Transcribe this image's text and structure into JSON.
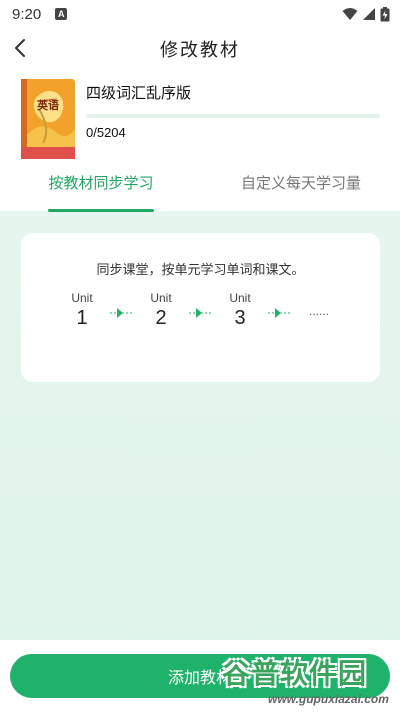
{
  "status_bar": {
    "time": "9:20",
    "badge": "A"
  },
  "header": {
    "title": "修改教材"
  },
  "book": {
    "name": "四级词汇乱序版",
    "cover_text": "英语",
    "progress_text": "0/5204",
    "progress_fraction": 0.0
  },
  "tabs": [
    {
      "label": "按教材同步学习",
      "active": true
    },
    {
      "label": "自定义每天学习量",
      "active": false
    }
  ],
  "sync_card": {
    "description": "同步课堂，按单元学习单词和课文。",
    "units": [
      {
        "label": "Unit",
        "number": "1"
      },
      {
        "label": "Unit",
        "number": "2"
      },
      {
        "label": "Unit",
        "number": "3"
      }
    ],
    "ellipsis": "......"
  },
  "bottom": {
    "button_label": "添加教材"
  },
  "watermark": {
    "text": "谷普软件园",
    "url": "www.gupuxiazai.com"
  },
  "colors": {
    "accent": "#22a862",
    "button": "#1fb26a",
    "card_bg": "#ffffff",
    "page_bg": "#def3e8"
  },
  "icons": {
    "back": "chevron-left-icon",
    "wifi": "wifi-icon",
    "signal": "signal-icon",
    "battery": "battery-icon"
  }
}
